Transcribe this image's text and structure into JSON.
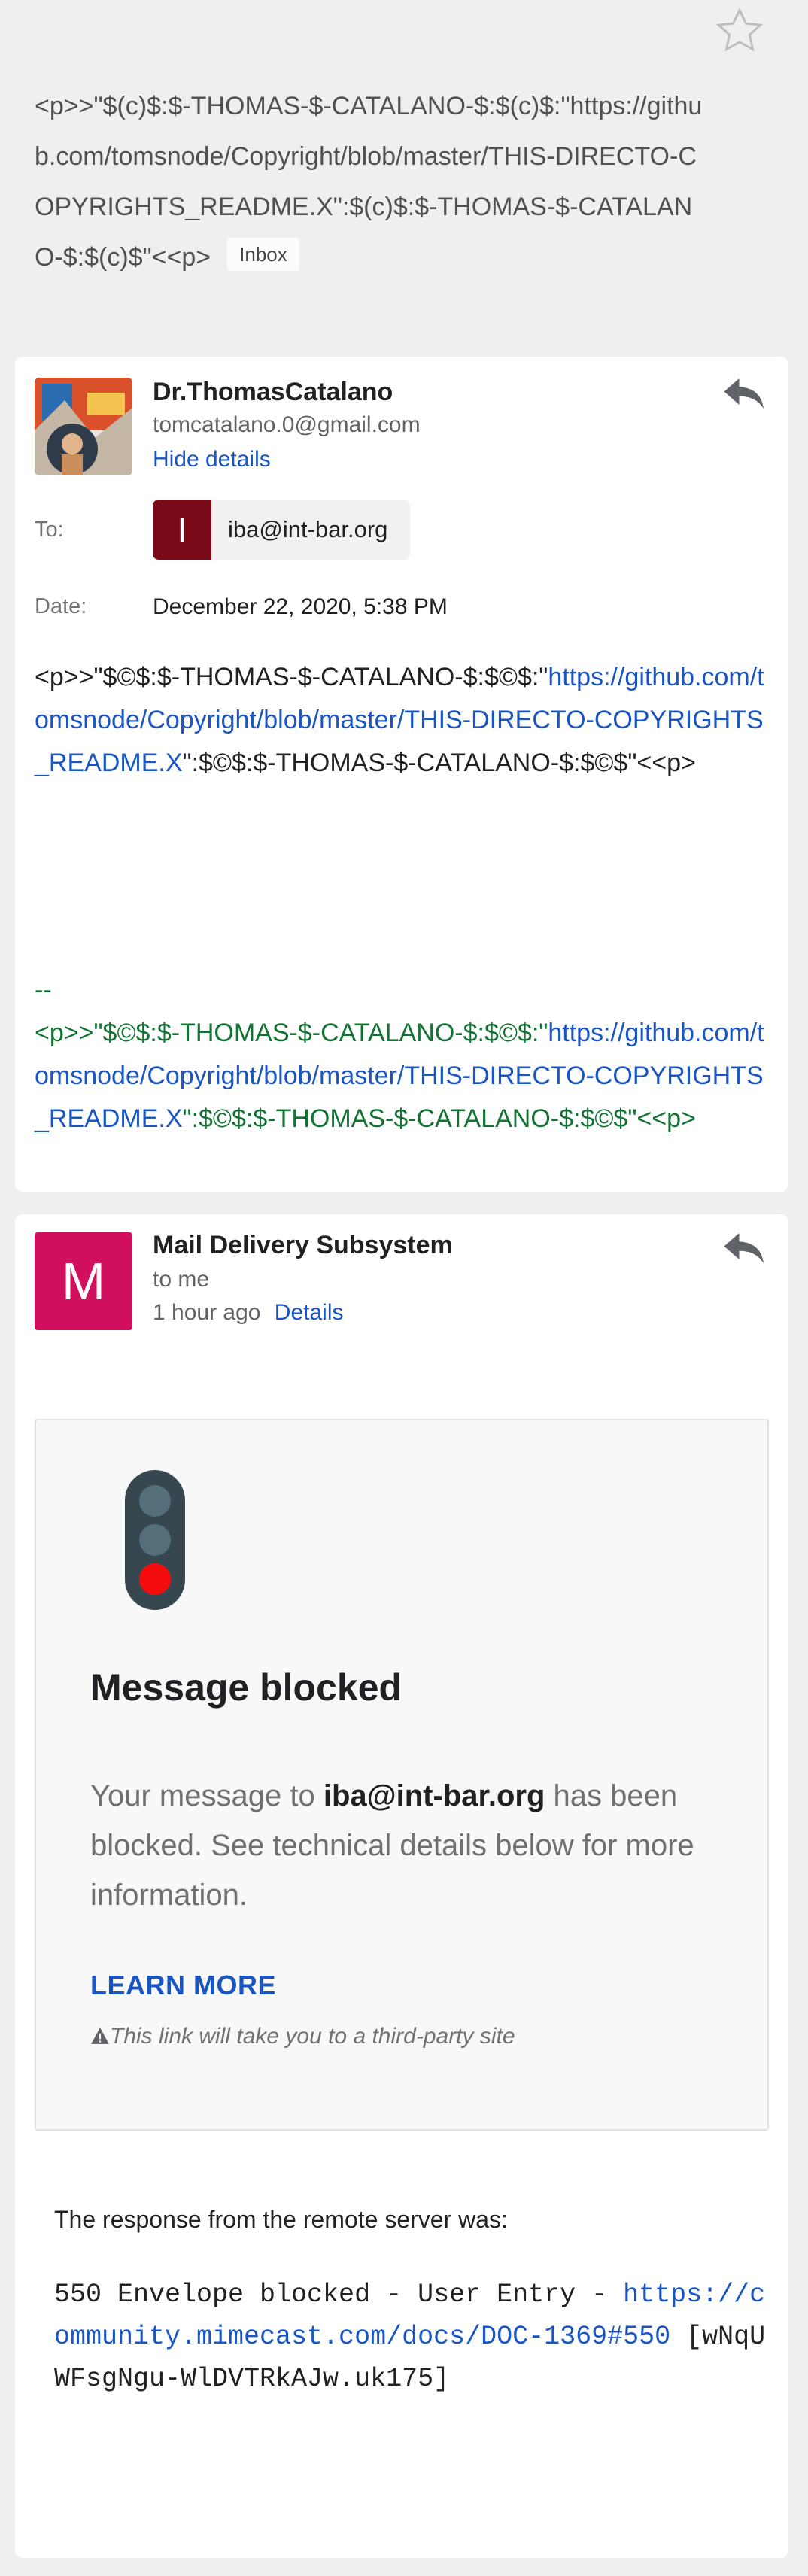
{
  "subject": {
    "text": "<p>>\"$(c)$:$-THOMAS-$-CATALANO-$:$(c)$:\"https://github.com/tomsnode/Copyright/blob/master/THIS-DIRECTO-COPYRIGHTS_README.X\":$(c)$:$-THOMAS-$-CATALANO-$:$(c)$\"<<p>",
    "badge": "Inbox"
  },
  "message1": {
    "sender": "Dr.ThomasCatalano",
    "email": "tomcatalano.0@gmail.com",
    "hide_details": "Hide details",
    "to_label": "To:",
    "to_initial": "I",
    "to_email": "iba@int-bar.org",
    "date_label": "Date:",
    "date": "December 22, 2020, 5:38 PM",
    "body_prefix": "<p>>\"$©$:$-THOMAS-$-CATALANO-$:$©$:\"",
    "body_link": "https://github.com/tomsnode/Copyright/blob/master/THIS-DIRECTO-COPYRIGHTS_README.X",
    "body_suffix": "\":$©$:$-THOMAS-$-CATALANO-$:$©$\"<<p>",
    "sig_dashes": "--",
    "sig_prefix": "<p>>\"$©$:$-THOMAS-$-CATALANO-$:$©$:\"",
    "sig_link": "https://github.com/tomsnode/Copyright/blob/master/THIS-DIRECTO-COPYRIGHTS_README.X",
    "sig_suffix": "\":$©$:$-THOMAS-$-CATALANO-$:$©$\"<<p>"
  },
  "message2": {
    "avatar_letter": "M",
    "sender": "Mail Delivery Subsystem",
    "to": "to me",
    "time": "1 hour ago",
    "details": "Details",
    "blocked_title": "Message blocked",
    "desc_pre": "Your message to ",
    "desc_email": "iba@int-bar.org",
    "desc_post": " has been blocked. See technical details below for more information.",
    "learn_more": "LEARN MORE",
    "warning": "This link will take you to a third-party site",
    "response_label": "The response from the remote server was:",
    "resp_prefix": "550 Envelope blocked - User Entry - ",
    "resp_link": "https://community.mimecast.com/docs/DOC-1369#550",
    "resp_suffix": " [wNqUWFsgNgu-WlDVTRkAJw.uk175]"
  },
  "icons": [
    "star-icon",
    "reply-icon",
    "warning-icon",
    "traffic-light-icon"
  ],
  "colors": {
    "link": "#1a55c4",
    "signature": "#137333",
    "chip": "#7b0a18",
    "avatar_m": "#d0105f"
  }
}
